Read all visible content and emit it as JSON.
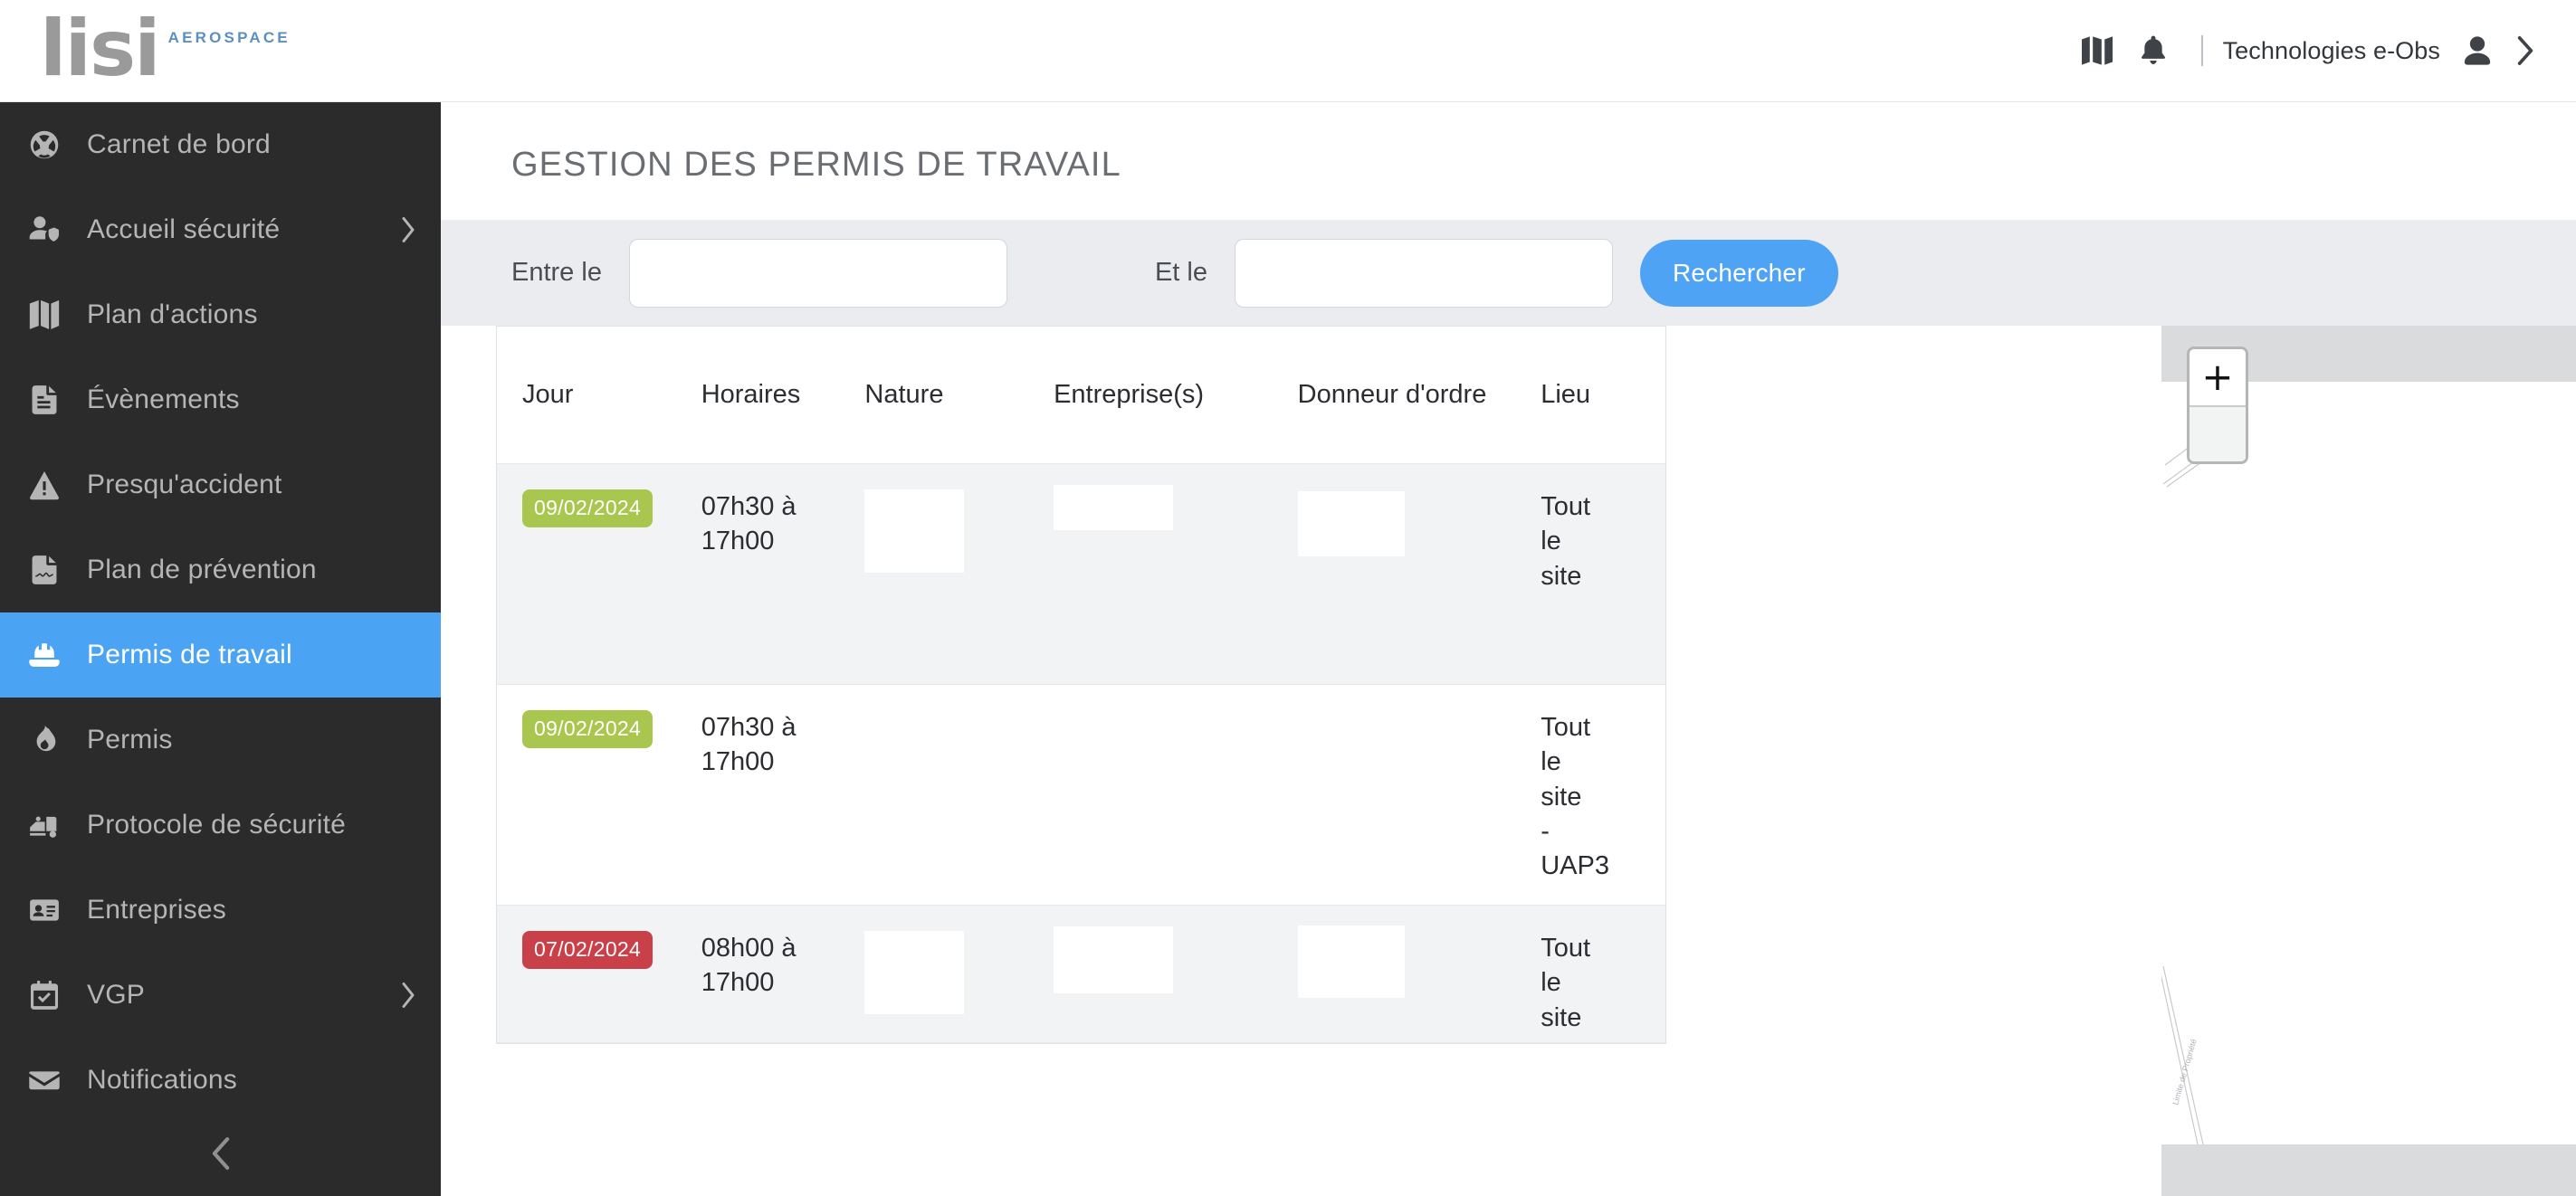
{
  "header": {
    "brand_name": "lisi",
    "brand_suffix": "AEROSPACE",
    "map_icon": "map-icon",
    "bell_icon": "bell-icon",
    "user_name": "Technologies e-Obs",
    "user_icon": "person-icon",
    "expand_icon": "chevron-right-icon"
  },
  "sidebar": {
    "items": [
      {
        "label": "Carnet de bord",
        "icon": "dashboard-icon",
        "active": false,
        "has_submenu": false
      },
      {
        "label": "Accueil sécurité",
        "icon": "user-shield-icon",
        "active": false,
        "has_submenu": true
      },
      {
        "label": "Plan d'actions",
        "icon": "map-icon",
        "active": false,
        "has_submenu": false
      },
      {
        "label": "Évènements",
        "icon": "document-icon",
        "active": false,
        "has_submenu": false
      },
      {
        "label": "Presqu'accident",
        "icon": "warning-icon",
        "active": false,
        "has_submenu": false
      },
      {
        "label": "Plan de prévention",
        "icon": "contract-icon",
        "active": false,
        "has_submenu": false
      },
      {
        "label": "Permis de travail",
        "icon": "helmet-icon",
        "active": true,
        "has_submenu": false
      },
      {
        "label": "Permis",
        "icon": "flame-icon",
        "active": false,
        "has_submenu": false
      },
      {
        "label": "Protocole de sécurité",
        "icon": "truck-icon",
        "active": false,
        "has_submenu": false
      },
      {
        "label": "Entreprises",
        "icon": "id-card-icon",
        "active": false,
        "has_submenu": false
      },
      {
        "label": "VGP",
        "icon": "calendar-check-icon",
        "active": false,
        "has_submenu": true
      },
      {
        "label": "Notifications",
        "icon": "envelope-icon",
        "active": false,
        "has_submenu": false
      }
    ],
    "collapse_icon": "chevron-left-icon"
  },
  "page": {
    "title": "GESTION DES PERMIS DE TRAVAIL"
  },
  "filters": {
    "from_label": "Entre le",
    "from_value": "",
    "from_placeholder": "",
    "to_label": "Et le",
    "to_value": "",
    "to_placeholder": "",
    "search_button": "Rechercher"
  },
  "table": {
    "columns": [
      "Jour",
      "Horaires",
      "Nature",
      "Entreprise(s)",
      "Donneur d'ordre",
      "Lieu"
    ],
    "rows": [
      {
        "jour": "09/02/2024",
        "jour_status": "green",
        "horaires": "07h30 à 17h00",
        "nature": "",
        "entreprises": "",
        "donneur": "",
        "lieu": "Tout le site",
        "redacted": true,
        "stripe": "alt"
      },
      {
        "jour": "09/02/2024",
        "jour_status": "green",
        "horaires": "07h30 à 17h00",
        "nature": "",
        "entreprises": "",
        "donneur": "",
        "lieu": "Tout le site - UAP3",
        "redacted": false,
        "stripe": "plain"
      },
      {
        "jour": "07/02/2024",
        "jour_status": "red",
        "horaires": "08h00 à 17h00",
        "nature": "",
        "entreprises": "",
        "donneur": "",
        "lieu": "Tout le site",
        "redacted": true,
        "stripe": "alt"
      }
    ]
  },
  "map": {
    "zoom_in_label": "+",
    "zoom_in_icon": "plus-icon",
    "zoom_out_icon": "minus-icon",
    "polygon_icon": "polygon-icon",
    "circle_icon": "circle-icon"
  },
  "colors": {
    "accent_blue": "#4ea3f5",
    "sidebar_bg": "#2b2b2b",
    "badge_green": "#a9c74e",
    "badge_red": "#ca4049",
    "filter_bg": "#eaecf0",
    "brand_grey": "#9a9a9a",
    "brand_blue": "#5a8fc0"
  }
}
